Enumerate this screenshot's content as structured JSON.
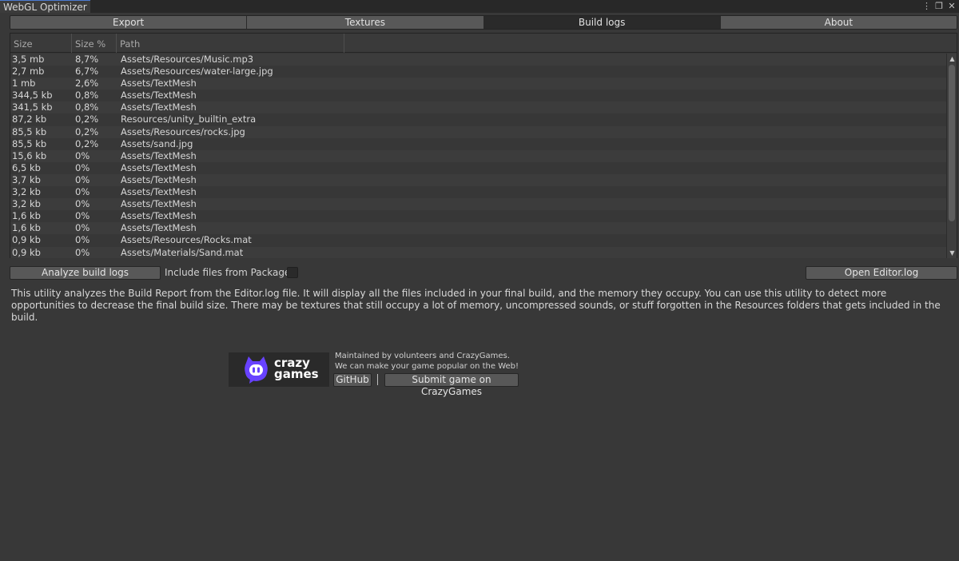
{
  "window": {
    "title": "WebGL Optimizer",
    "controls": [
      "⋮",
      "❐",
      "✕"
    ]
  },
  "tabs": [
    {
      "label": "Export"
    },
    {
      "label": "Textures"
    },
    {
      "label": "Build logs",
      "active": true
    },
    {
      "label": "About"
    }
  ],
  "table": {
    "columns": [
      "Size",
      "Size %",
      "Path"
    ],
    "rows": [
      {
        "size": "3,5 mb",
        "pct": "8,7%",
        "path": "Assets/Resources/Music.mp3"
      },
      {
        "size": "2,7 mb",
        "pct": "6,7%",
        "path": "Assets/Resources/water-large.jpg"
      },
      {
        "size": "1 mb",
        "pct": "2,6%",
        "path": "Assets/TextMesh"
      },
      {
        "size": "344,5 kb",
        "pct": "0,8%",
        "path": "Assets/TextMesh"
      },
      {
        "size": "341,5 kb",
        "pct": "0,8%",
        "path": "Assets/TextMesh"
      },
      {
        "size": "87,2 kb",
        "pct": "0,2%",
        "path": "Resources/unity_builtin_extra"
      },
      {
        "size": "85,5 kb",
        "pct": "0,2%",
        "path": "Assets/Resources/rocks.jpg"
      },
      {
        "size": "85,5 kb",
        "pct": "0,2%",
        "path": "Assets/sand.jpg"
      },
      {
        "size": "15,6 kb",
        "pct": "0%",
        "path": "Assets/TextMesh"
      },
      {
        "size": "6,5 kb",
        "pct": "0%",
        "path": "Assets/TextMesh"
      },
      {
        "size": "3,7 kb",
        "pct": "0%",
        "path": "Assets/TextMesh"
      },
      {
        "size": "3,2 kb",
        "pct": "0%",
        "path": "Assets/TextMesh"
      },
      {
        "size": "3,2 kb",
        "pct": "0%",
        "path": "Assets/TextMesh"
      },
      {
        "size": "1,6 kb",
        "pct": "0%",
        "path": "Assets/TextMesh"
      },
      {
        "size": "1,6 kb",
        "pct": "0%",
        "path": "Assets/TextMesh"
      },
      {
        "size": "0,9 kb",
        "pct": "0%",
        "path": "Assets/Resources/Rocks.mat"
      },
      {
        "size": "0,9 kb",
        "pct": "0%",
        "path": "Assets/Materials/Sand.mat"
      }
    ],
    "scroll_up": "▲",
    "scroll_down": "▼"
  },
  "actions": {
    "analyze_label": "Analyze build logs",
    "include_packages_label": "Include files from Packages",
    "include_packages_checked": false,
    "open_editor_log_label": "Open Editor.log"
  },
  "description": "This utility analyzes the Build Report from the Editor.log file. It will display all the files included in your final build, and the memory they occupy. You can use this utility to detect more opportunities to decrease the final build size. There may be textures that still occupy a lot of memory, uncompressed sounds, or stuff forgotten in the Resources folders that gets included in the build.",
  "footer": {
    "logo_line1": "crazy",
    "logo_line2": "games",
    "line1": "Maintained by volunteers and CrazyGames.",
    "line2": "We can make your game popular on the Web!",
    "github_label": "GitHub",
    "submit_label": "Submit game on CrazyGames"
  },
  "colors": {
    "background": "#383838",
    "logo_purple": "#6842ff"
  }
}
